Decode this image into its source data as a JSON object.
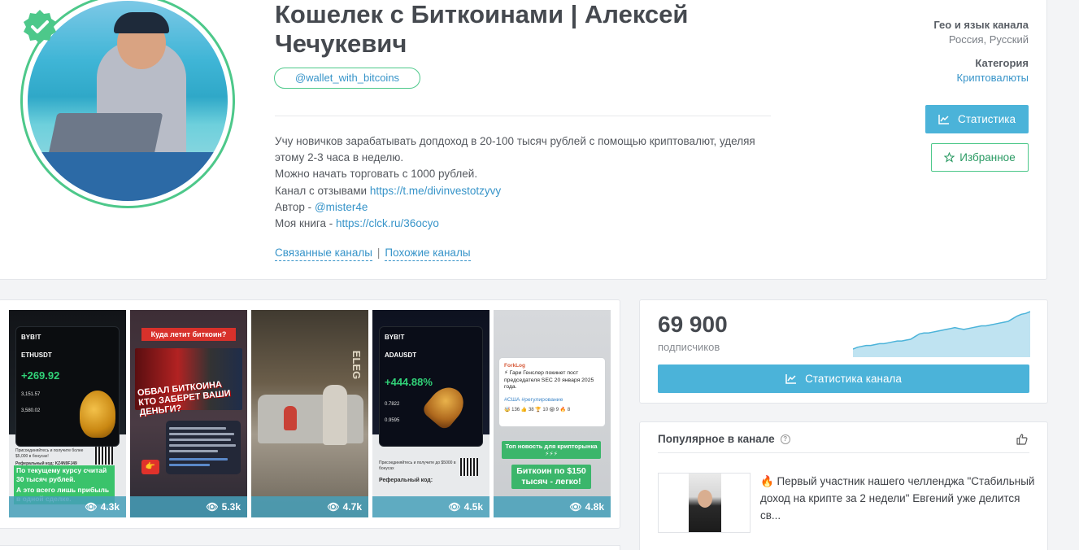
{
  "channel": {
    "title": "Кошелек с Биткоинами | Алексей Чечукевич",
    "handle": "@wallet_with_bitcoins",
    "description": {
      "line1": "Учу новичков зарабатывать допдоход в 20-100 тысяч рублей с помощью криптовалют, уделяя этому 2-3 часа в неделю.",
      "line2": "Можно начать торговать с 1000 рублей.",
      "reviews_label": "Канал с отзывами",
      "reviews_link": "https://t.me/divinvestotzyvy",
      "author_label": "Автор -",
      "author_link": "@mister4e",
      "book_label": "Моя книга -",
      "book_link": "https://clck.ru/36ocyo"
    },
    "related_channels": "Связанные каналы",
    "similar_channels": "Похожие каналы",
    "separator": "|"
  },
  "meta": {
    "geo_label": "Гео и язык канала",
    "geo_value": "Россия, Русский",
    "category_label": "Категория",
    "category_value": "Криптовалюты"
  },
  "buttons": {
    "statistics": "Статистика",
    "favorites": "Избранное",
    "channel_statistics": "Статистика канала"
  },
  "subscribers": {
    "count": "69 900",
    "label": "подписчиков"
  },
  "posts": [
    {
      "views": "4.3k",
      "brand": "BYB!T",
      "pair": "ETHUSDT",
      "value": "+269.92",
      "entry": "3,151.57",
      "current": "3,580.02",
      "promo": "Присоединяйтесь и получите более $5,000 в бонусах!",
      "ref": "Реферальный код: KZ4N9FJ49",
      "caption_1": "По текущему курсу считай 30 тысяч рублей.",
      "caption_2": "А это всего лишь прибыль в одной сделке."
    },
    {
      "views": "5.3k",
      "banner": "Куда летит биткоин?",
      "headline": "ОБВАЛ БИТКОИНА КТО ЗАБЕРЕТ ВАШИ ДЕНЬГИ?"
    },
    {
      "views": "4.7k",
      "sign": "ELEG"
    },
    {
      "views": "4.5k",
      "brand": "BYB!T",
      "pair": "ADAUSDT",
      "value": "+444.88%",
      "entry": "0.7822",
      "current": "0.9595",
      "promo": "Присоединяйтесь и получите до $5000 в бонусах",
      "ref": "Реферальный код:"
    },
    {
      "views": "4.8k",
      "source": "ForkLog",
      "news": "⚡ Гари Генслер покинет пост председателя SEC 20 января 2025 года.",
      "tags": "#США #регулирование",
      "reactions": "🤯 136  👍 38  🏆 10  😱 9  🔥 8",
      "pill_1": "Топ новость для крипторынка ⚡⚡⚡",
      "pill_2": "Биткоин по $150 тысяч - легко!"
    }
  ],
  "popular": {
    "title": "Популярное в канале",
    "help": "?",
    "post_text": "🔥 Первый участник нашего челленджа \"Стабильный доход на крипте за 2 недели\" Евгений уже делится св..."
  },
  "colors": {
    "accent_blue": "#4bb3d9",
    "accent_green": "#4dc88a",
    "link": "#3794c9"
  },
  "chart_data": {
    "type": "area",
    "series": [
      {
        "values": [
          8,
          10,
          11,
          12,
          12,
          13,
          14,
          14,
          15,
          16,
          17,
          17,
          18,
          19,
          22,
          25,
          26,
          26,
          27,
          28,
          29,
          30,
          31,
          32,
          31,
          30,
          31,
          32,
          33,
          34,
          34,
          35,
          36,
          37,
          38,
          39,
          42,
          45,
          47,
          48,
          50
        ]
      }
    ]
  }
}
